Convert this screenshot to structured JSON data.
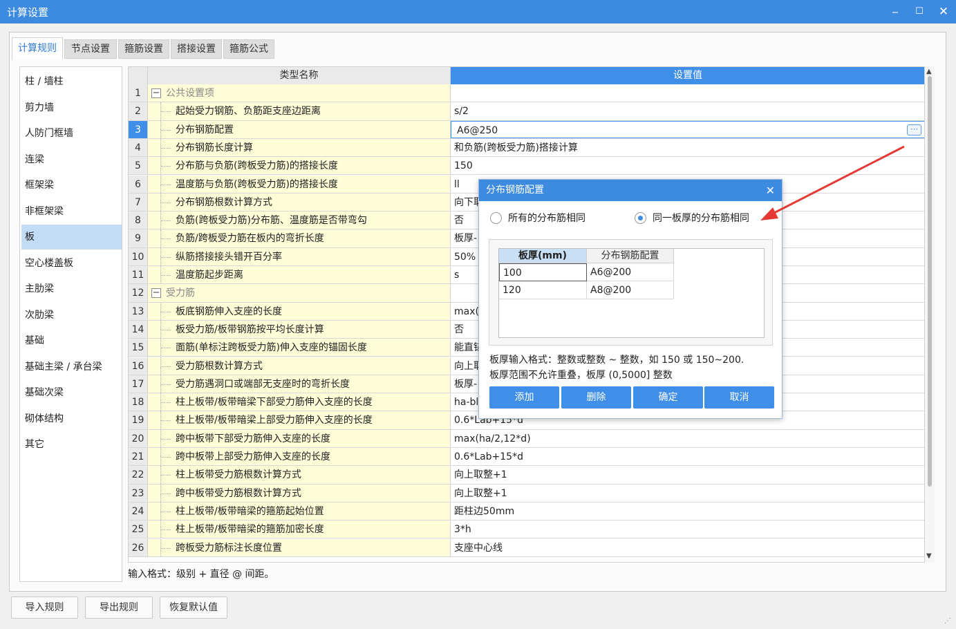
{
  "window": {
    "title": "计算设置",
    "minimize": "‒",
    "maximize": "☐",
    "close": "✕"
  },
  "tabs": [
    "计算规则",
    "节点设置",
    "箍筋设置",
    "搭接设置",
    "箍筋公式"
  ],
  "sidebar": [
    "柱 / 墙柱",
    "剪力墙",
    "人防门框墙",
    "连梁",
    "框架梁",
    "非框架梁",
    "板",
    "空心楼盖板",
    "主肋梁",
    "次肋梁",
    "基础",
    "基础主梁 / 承台梁",
    "基础次梁",
    "砌体结构",
    "其它"
  ],
  "grid": {
    "header_name": "类型名称",
    "header_value": "设置值",
    "ellipsis": "⋯",
    "rows": [
      {
        "num": "1",
        "name": "公共设置项",
        "value": ""
      },
      {
        "num": "2",
        "name": "起始受力钢筋、负筋距支座边距离",
        "value": "s/2"
      },
      {
        "num": "3",
        "name": "分布钢筋配置",
        "value": "A6@250"
      },
      {
        "num": "4",
        "name": "分布钢筋长度计算",
        "value": "和负筋(跨板受力筋)搭接计算"
      },
      {
        "num": "5",
        "name": "分布筋与负筋(跨板受力筋)的搭接长度",
        "value": "150"
      },
      {
        "num": "6",
        "name": "温度筋与负筋(跨板受力筋)的搭接长度",
        "value": "ll"
      },
      {
        "num": "7",
        "name": "分布钢筋根数计算方式",
        "value": "向下取"
      },
      {
        "num": "8",
        "name": "负筋(跨板受力筋)分布筋、温度筋是否带弯勾",
        "value": "否"
      },
      {
        "num": "9",
        "name": "负筋/跨板受力筋在板内的弯折长度",
        "value": "板厚-"
      },
      {
        "num": "10",
        "name": "纵筋搭接接头错开百分率",
        "value": "50%"
      },
      {
        "num": "11",
        "name": "温度筋起步距离",
        "value": "s"
      },
      {
        "num": "12",
        "name": "受力筋",
        "value": ""
      },
      {
        "num": "13",
        "name": "板底钢筋伸入支座的长度",
        "value": "max("
      },
      {
        "num": "14",
        "name": "板受力筋/板带钢筋按平均长度计算",
        "value": "否"
      },
      {
        "num": "15",
        "name": "面筋(单标注跨板受力筋)伸入支座的锚固长度",
        "value": "能直锚"
      },
      {
        "num": "16",
        "name": "受力筋根数计算方式",
        "value": "向上取"
      },
      {
        "num": "17",
        "name": "受力筋遇洞口或端部无支座时的弯折长度",
        "value": "板厚-"
      },
      {
        "num": "18",
        "name": "柱上板带/板带暗梁下部受力筋伸入支座的长度",
        "value": "ha-bl"
      },
      {
        "num": "19",
        "name": "柱上板带/板带暗梁上部受力筋伸入支座的长度",
        "value": "0.6*Lab+15*d"
      },
      {
        "num": "20",
        "name": "跨中板带下部受力筋伸入支座的长度",
        "value": "max(ha/2,12*d)"
      },
      {
        "num": "21",
        "name": "跨中板带上部受力筋伸入支座的长度",
        "value": "0.6*Lab+15*d"
      },
      {
        "num": "22",
        "name": "柱上板带受力筋根数计算方式",
        "value": "向上取整+1"
      },
      {
        "num": "23",
        "name": "跨中板带受力筋根数计算方式",
        "value": "向上取整+1"
      },
      {
        "num": "24",
        "name": "柱上板带/板带暗梁的箍筋起始位置",
        "value": "距柱边50mm"
      },
      {
        "num": "25",
        "name": "柱上板带/板带暗梁的箍筋加密长度",
        "value": "3*h"
      },
      {
        "num": "26",
        "name": "跨板受力筋标注长度位置",
        "value": "支座中心线"
      }
    ]
  },
  "hint": "输入格式：级别 + 直径 @ 间距。",
  "buttons": {
    "import": "导入规则",
    "export": "导出规则",
    "restore": "恢复默认值"
  },
  "dialog": {
    "title": "分布钢筋配置",
    "close": "✕",
    "radio_all": "所有的分布筋相同",
    "radio_same": "同一板厚的分布筋相同",
    "table_header_thickness": "板厚(mm)",
    "table_header_config": "分布钢筋配置",
    "rows": [
      {
        "thickness": "100",
        "config": "A6@200"
      },
      {
        "thickness": "120",
        "config": "A8@200"
      }
    ],
    "note1": "板厚输入格式：整数或整数 ~ 整数，如 150 或 150~200.",
    "note2": "板厚范围不允许重叠，板厚 (0,5000] 整数",
    "btn_add": "添加",
    "btn_delete": "删除",
    "btn_ok": "确定",
    "btn_cancel": "取消"
  },
  "colors": {
    "accent": "#3c8be0",
    "name_cell_bg": "#fffdd8",
    "selected_sidebar": "#c3dcf5",
    "annotation_arrow": "#e53935"
  }
}
